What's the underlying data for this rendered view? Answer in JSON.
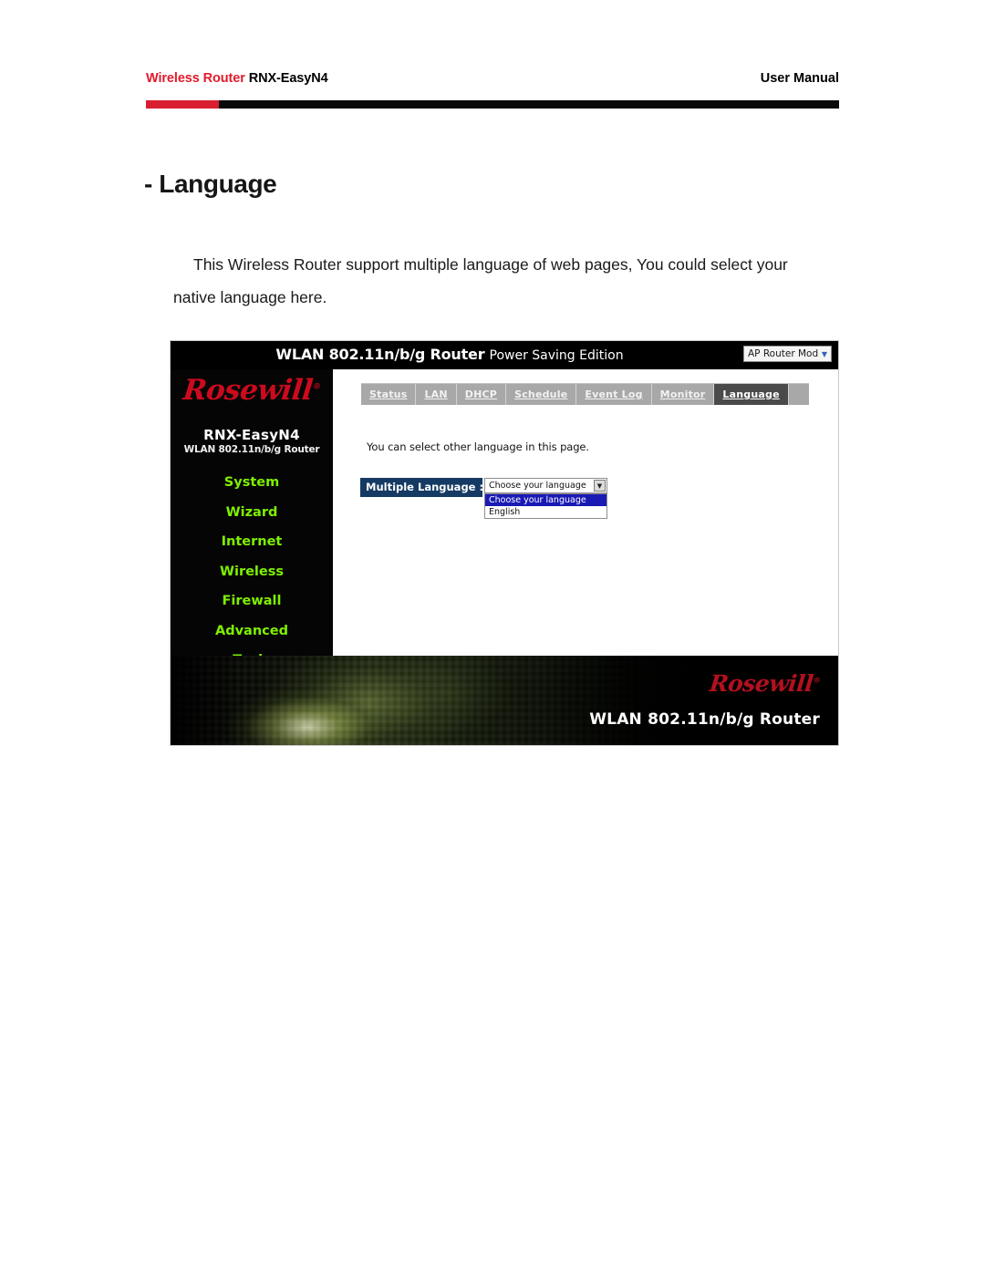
{
  "doc": {
    "header_left_red": "Wireless Router",
    "header_left_black": "RNX-EasyN4",
    "header_right": "User Manual",
    "title": "- Language",
    "paragraph": "This Wireless Router support multiple language of web pages, You could select your native language here."
  },
  "router_ui": {
    "topbar": {
      "title_bold": "WLAN 802.11n/b/g Router",
      "title_light": "Power Saving Edition",
      "mode_select_value": "AP Router Mode",
      "mode_select_arrow": "▼"
    },
    "sidebar": {
      "logo": "Rosewill",
      "logo_mark": "®",
      "model": "RNX-EasyN4",
      "subtitle": "WLAN 802.11n/b/g Router",
      "items": [
        {
          "label": "System"
        },
        {
          "label": "Wizard"
        },
        {
          "label": "Internet"
        },
        {
          "label": "Wireless"
        },
        {
          "label": "Firewall"
        },
        {
          "label": "Advanced"
        },
        {
          "label": "Tools"
        }
      ]
    },
    "tabs": [
      {
        "label": "Status",
        "active": false
      },
      {
        "label": "LAN",
        "active": false
      },
      {
        "label": "DHCP",
        "active": false
      },
      {
        "label": "Schedule",
        "active": false
      },
      {
        "label": "Event Log",
        "active": false
      },
      {
        "label": "Monitor",
        "active": false
      },
      {
        "label": "Language",
        "active": true
      }
    ],
    "content": {
      "note": "You can select other language in this page.",
      "language_label": "Multiple Language :",
      "language_selected": "Choose your language",
      "language_arrow": "▼",
      "language_options": [
        {
          "label": "Choose your language",
          "selected": true
        },
        {
          "label": "English",
          "selected": false
        }
      ]
    },
    "footer": {
      "logo": "Rosewill",
      "logo_mark": "®",
      "title": "WLAN 802.11n/b/g Router"
    }
  },
  "colors": {
    "brand_red": "#e21b2c",
    "logo_red": "#cc0a1e",
    "nav_green": "#7ef000",
    "label_navy": "#153a63",
    "option_highlight": "#1a1ab4"
  }
}
